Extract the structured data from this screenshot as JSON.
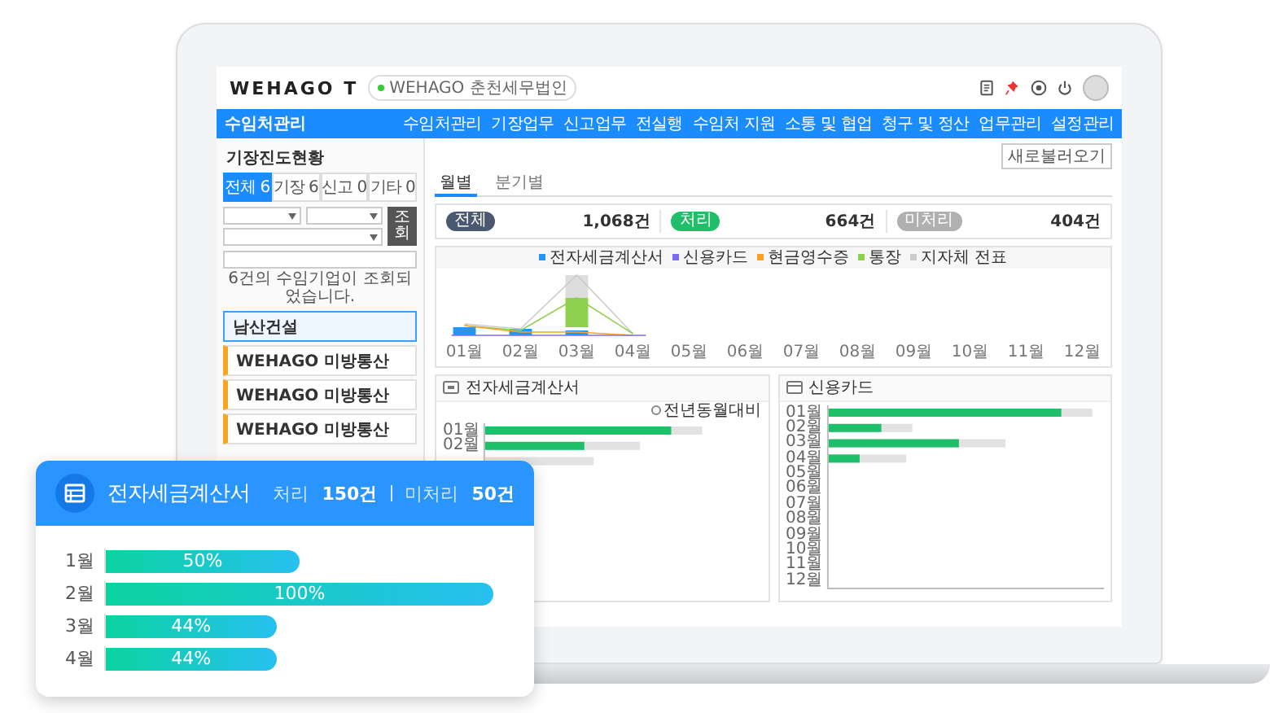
{
  "app": {
    "logo": "WEHAGO T",
    "company_chip": "WEHAGO 춘천세무법인",
    "title": "수임처관리",
    "menu": [
      "수임처관리",
      "기장업무",
      "신고업무",
      "전실행",
      "수임처 지원",
      "소통 및 협업",
      "청구 및 정산",
      "업무관리",
      "설정관리"
    ]
  },
  "left_panel": {
    "title": "기장진도현황",
    "tabs": [
      {
        "label": "전체 6",
        "selected": true
      },
      {
        "label": "기장 6",
        "selected": false
      },
      {
        "label": "신고 0",
        "selected": false
      },
      {
        "label": "기타 0",
        "selected": false
      }
    ],
    "search_button": "조회",
    "result": "6건의 수임기업이 조회되었습니다.",
    "clients": [
      {
        "name": "남산건설",
        "selected": true
      },
      {
        "name": "WEHAGO 미방통산",
        "selected": false
      },
      {
        "name": "WEHAGO 미방통산",
        "selected": false
      },
      {
        "name": "WEHAGO 미방통산",
        "selected": false
      }
    ]
  },
  "main": {
    "refresh_button": "새로불러오기",
    "view_tabs": [
      {
        "label": "월별",
        "selected": true
      },
      {
        "label": "분기별",
        "selected": false
      }
    ],
    "summary": [
      {
        "badge": "전체",
        "count": "1,068건",
        "color": "#4a5870"
      },
      {
        "badge": "처리",
        "count": "664건",
        "color": "#1fbf6a"
      },
      {
        "badge": "미처리",
        "count": "404건",
        "color": "#b0b0b0"
      }
    ],
    "legend": [
      {
        "label": "전자세금계산서",
        "color": "#2196f3"
      },
      {
        "label": "신용카드",
        "color": "#7b6cf0"
      },
      {
        "label": "현금영수증",
        "color": "#ffa026"
      },
      {
        "label": "통장",
        "color": "#8fd14f"
      },
      {
        "label": "지자체 전표",
        "color": "#cccccc"
      }
    ],
    "months": [
      "01월",
      "02월",
      "03월",
      "04월",
      "05월",
      "06월",
      "07월",
      "08월",
      "09월",
      "10월",
      "11월",
      "12월"
    ],
    "panels": [
      {
        "title": "전자세금계산서",
        "option": {
          "label": "전년동월대비",
          "checked": false
        },
        "row_labels": [
          "01월",
          "02월"
        ]
      },
      {
        "title": "신용카드",
        "row_labels": [
          "01월",
          "02월",
          "03월",
          "04월",
          "05월",
          "06월",
          "07월",
          "08월",
          "09월",
          "10월",
          "11월",
          "12월"
        ]
      }
    ]
  },
  "promo_card": {
    "title": "전자세금계산서",
    "processed_label": "처리",
    "processed_count": "150건",
    "unprocessed_label": "미처리",
    "unprocessed_count": "50건",
    "chart_data": {
      "type": "bar",
      "orientation": "horizontal",
      "categories": [
        "1월",
        "2월",
        "3월",
        "4월"
      ],
      "values": [
        50,
        100,
        44,
        44
      ],
      "value_labels": [
        "50%",
        "100%",
        "44%",
        "44%"
      ],
      "grid": true
    }
  }
}
